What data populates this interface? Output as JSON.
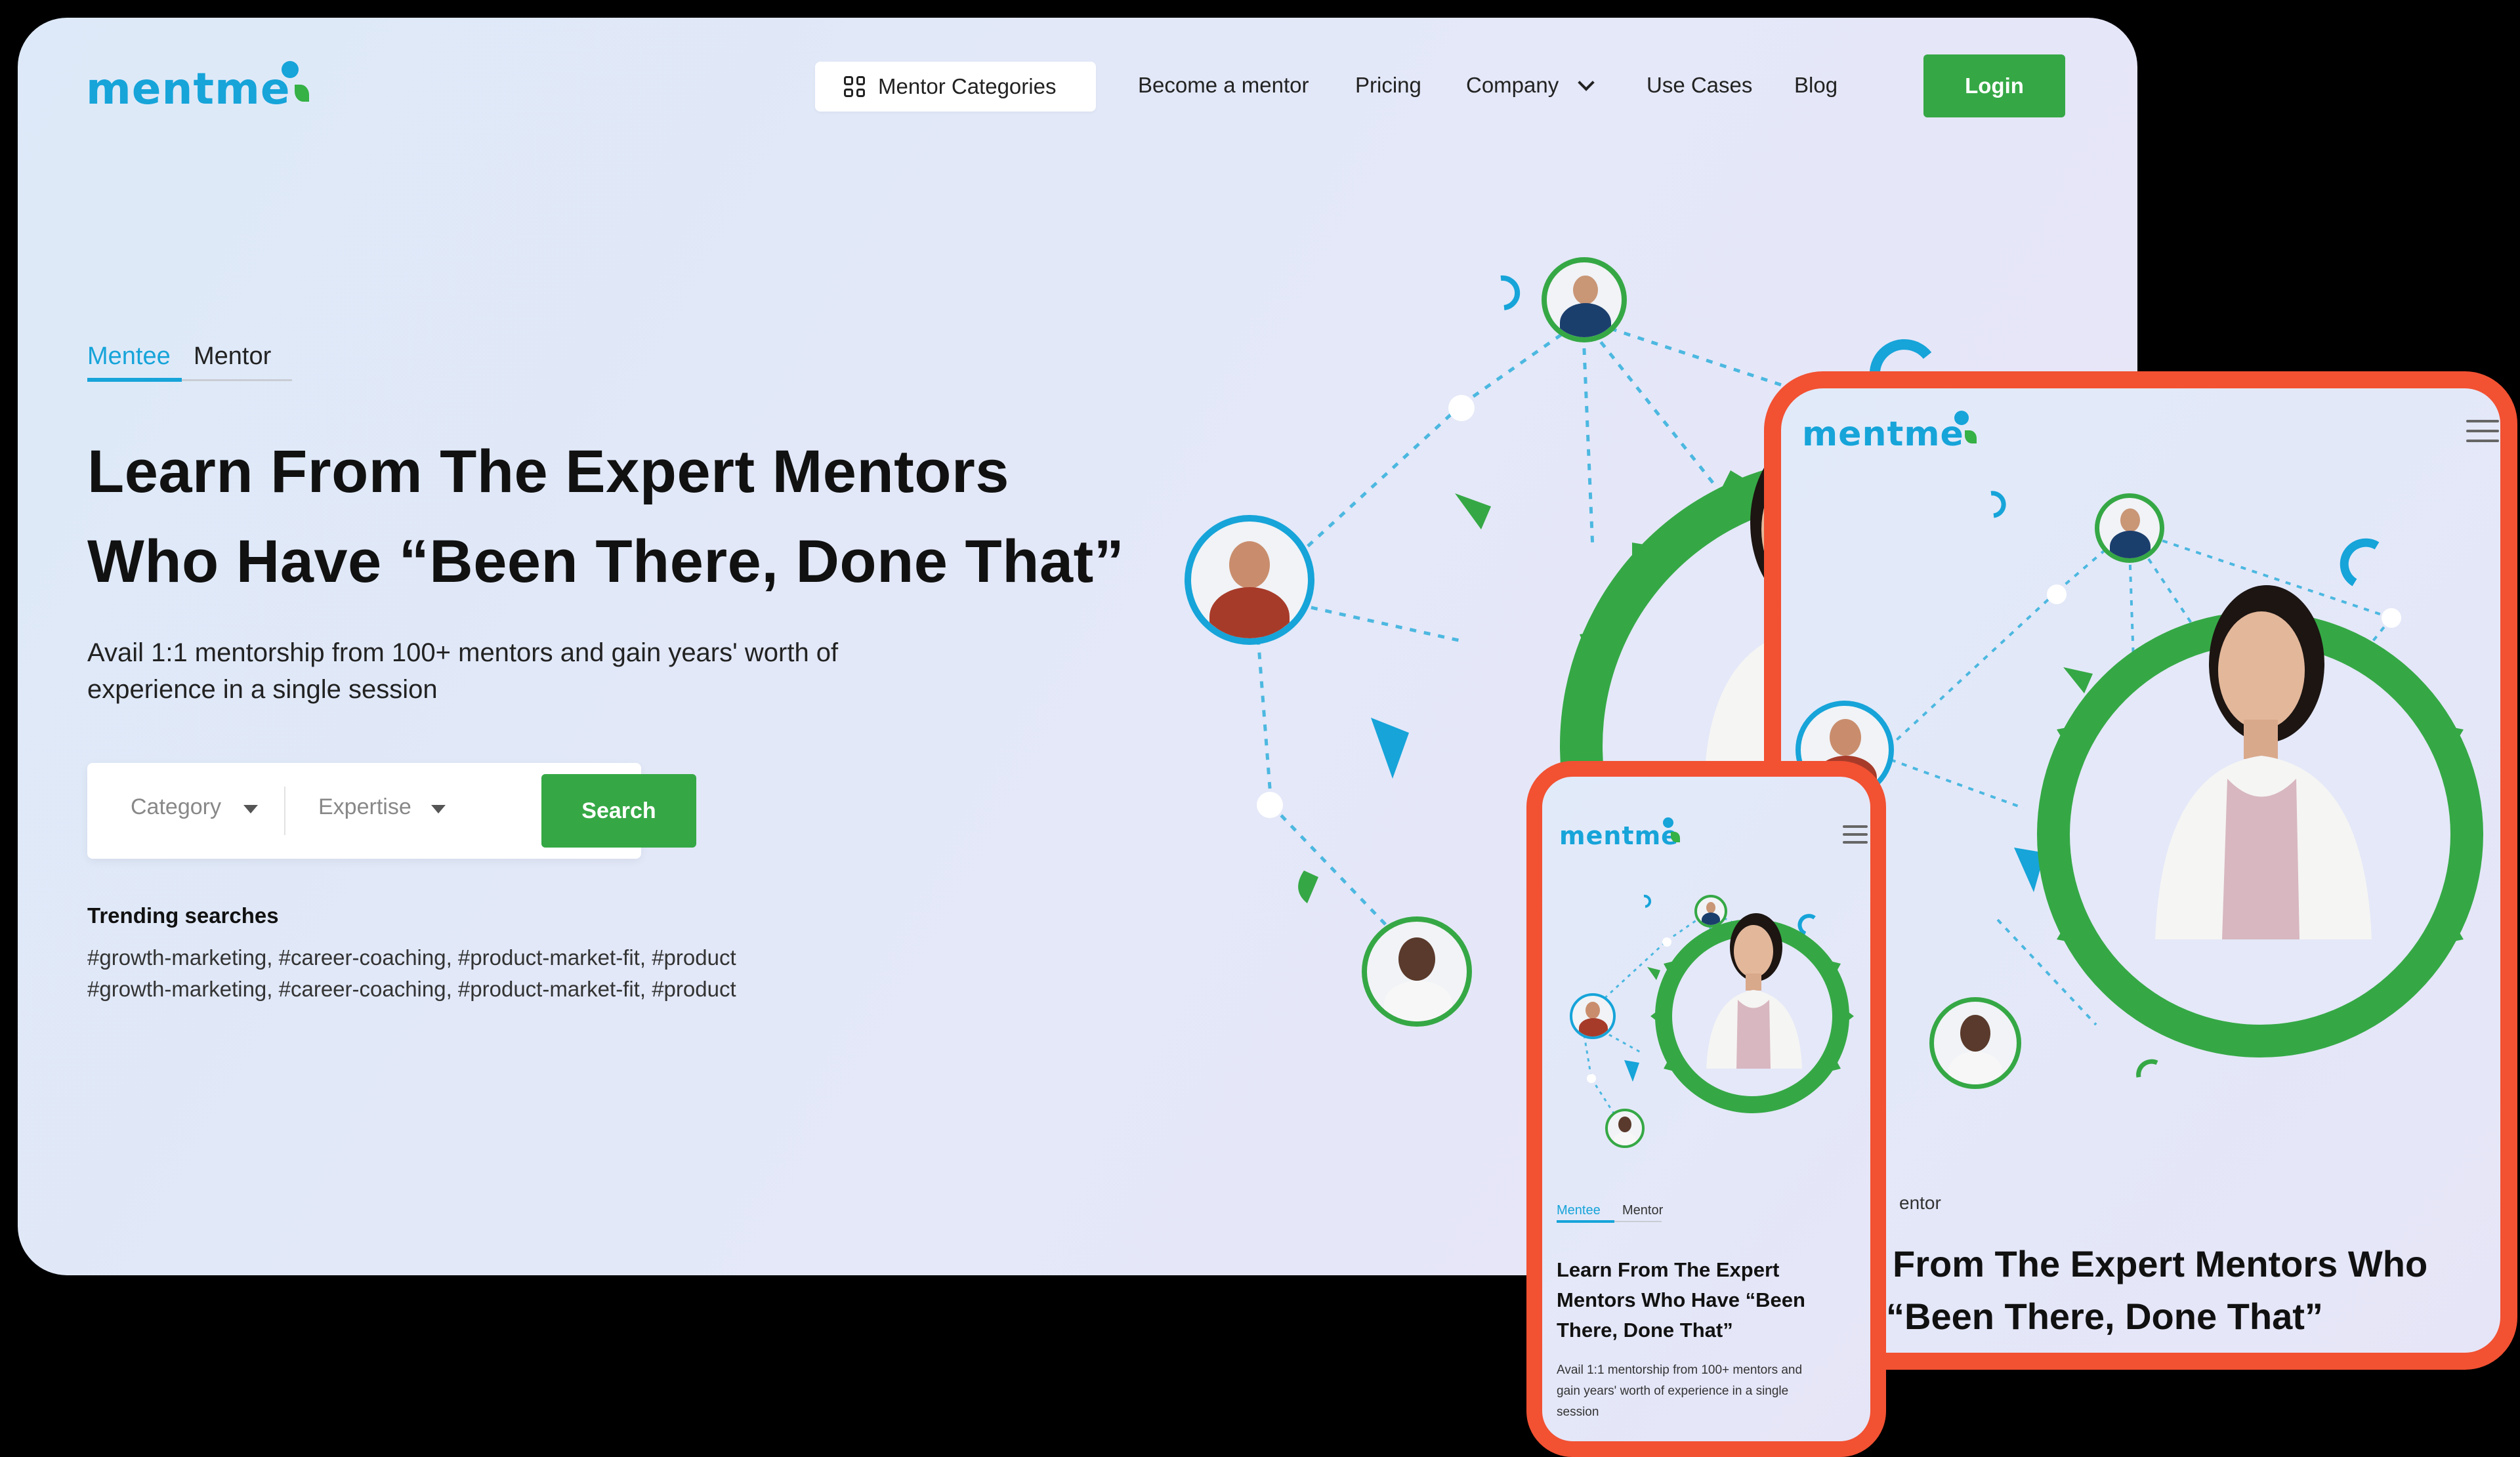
{
  "brand": {
    "name": "mentme",
    "accent": "#16a4d9",
    "green": "#35a845",
    "frame_color": "#f25132"
  },
  "nav": {
    "categories_label": "Mentor Categories",
    "links": [
      "Become a mentor",
      "Pricing",
      "Company",
      "Use Cases",
      "Blog"
    ],
    "login_label": "Login"
  },
  "hero": {
    "tabs": [
      "Mentee",
      "Mentor"
    ],
    "active_tab": "Mentee",
    "title_line1": "Learn From The Expert Mentors",
    "title_line2": "Who Have “Been There, Done That”",
    "subtitle_line1": "Avail 1:1 mentorship from 100+ mentors and gain years' worth of",
    "subtitle_line2": "experience in a single session",
    "search": {
      "category_placeholder": "Category",
      "expertise_placeholder": "Expertise",
      "button_label": "Search"
    },
    "trending_title": "Trending searches",
    "trending_line1": "#growth-marketing, #career-coaching, #product-market-fit, #product",
    "trending_line2": "#growth-marketing, #career-coaching, #product-market-fit, #product"
  },
  "tablet": {
    "tab_partial": "entor",
    "title_line1": "From The Expert Mentors Who",
    "title_line2": "“Been There, Done That”"
  },
  "phone": {
    "tabs": [
      "Mentee",
      "Mentor"
    ],
    "title_line1": "Learn From The Expert",
    "title_line2": "Mentors Who Have “Been",
    "title_line3": "There, Done That”",
    "subtitle_line1": "Avail 1:1 mentorship from 100+ mentors and",
    "subtitle_line2": "gain years' worth of experience in a single",
    "subtitle_line3": "session"
  }
}
